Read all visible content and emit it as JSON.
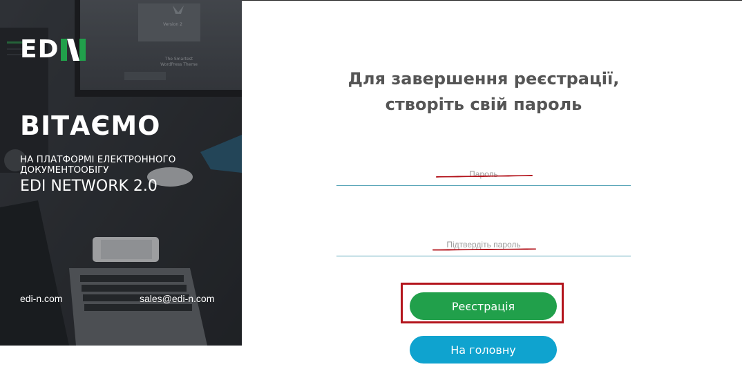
{
  "brand": {
    "logo_text": "ED",
    "logo_mark_color": "#21a04b",
    "welcome": "ВІТАЄМО",
    "subtitle": "НА ПЛАТФОРМІ ЕЛЕКТРОННОГО ДОКУМЕНТООБІГУ",
    "product": "EDI NETWORK 2.0",
    "website": "edi-n.com",
    "email": "sales@edi-n.com"
  },
  "background_image": {
    "screen_caption_1": "Version 2",
    "screen_caption_2": "The Smartest",
    "screen_caption_3": "WordPress Theme"
  },
  "form": {
    "heading_line1": "Для завершення реєстрації,",
    "heading_line2": "створіть свій пароль",
    "password_placeholder": "Пароль",
    "confirm_placeholder": "Підтвердіть пароль",
    "register_label": "Реєстрація",
    "home_label": "На головну"
  },
  "colors": {
    "register_button": "#21a04b",
    "home_button": "#0fa3cf",
    "annotation": "#b3141c",
    "input_underline": "#5aa6b8"
  }
}
